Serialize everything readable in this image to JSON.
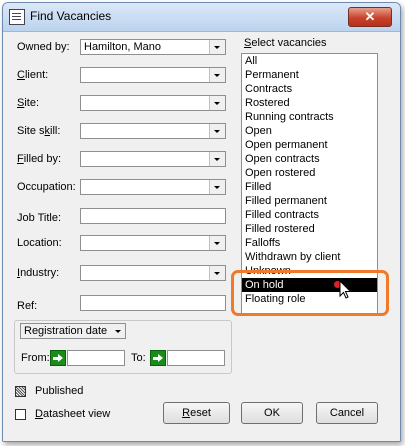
{
  "window": {
    "title": "Find Vacancies",
    "close_label": "✕"
  },
  "fields": {
    "owned_by": {
      "label": "Owned by:",
      "value": "Hamilton, Mano"
    },
    "client": {
      "label_u": "C",
      "label_rest": "lient:",
      "value": ""
    },
    "site": {
      "label_u": "S",
      "label_rest": "ite:",
      "value": ""
    },
    "site_skill": {
      "label_pre": "Site s",
      "label_u": "k",
      "label_rest": "ill:",
      "value": ""
    },
    "filled_by": {
      "label_u": "F",
      "label_rest": "illed by:",
      "value": ""
    },
    "occupation": {
      "label": "Occupation:",
      "value": ""
    },
    "job_title": {
      "label": "Job Title:",
      "value": ""
    },
    "location": {
      "label": "Location:",
      "value": ""
    },
    "industry": {
      "label_u": "I",
      "label_rest": "ndustry:",
      "value": ""
    },
    "ref": {
      "label": "Ref:",
      "value": ""
    }
  },
  "vacancies": {
    "label_u": "S",
    "label_rest": "elect vacancies",
    "items": [
      "All",
      "Permanent",
      "Contracts",
      "Rostered",
      "Running contracts",
      "Open",
      "Open permanent",
      "Open contracts",
      "Open rostered",
      "Filled",
      "Filled permanent",
      "Filled contracts",
      "Filled rostered",
      "Falloffs",
      "Withdrawn by client",
      "Unknown",
      "On hold",
      "Floating role"
    ],
    "selected": "On hold"
  },
  "date_filter": {
    "type": "Registration date",
    "from_label": "From:",
    "to_label": "To:",
    "from_value": "",
    "to_value": ""
  },
  "checkboxes": {
    "published": {
      "label": "Published",
      "state": "indeterminate"
    },
    "datasheet": {
      "label_u": "D",
      "label_rest": "atasheet view",
      "state": "unchecked"
    }
  },
  "buttons": {
    "reset_u": "R",
    "reset_rest": "eset",
    "ok": "OK",
    "cancel": "Cancel"
  },
  "colors": {
    "highlight": "#f07a2a",
    "selection": "#000000",
    "close": "#c8432c"
  }
}
